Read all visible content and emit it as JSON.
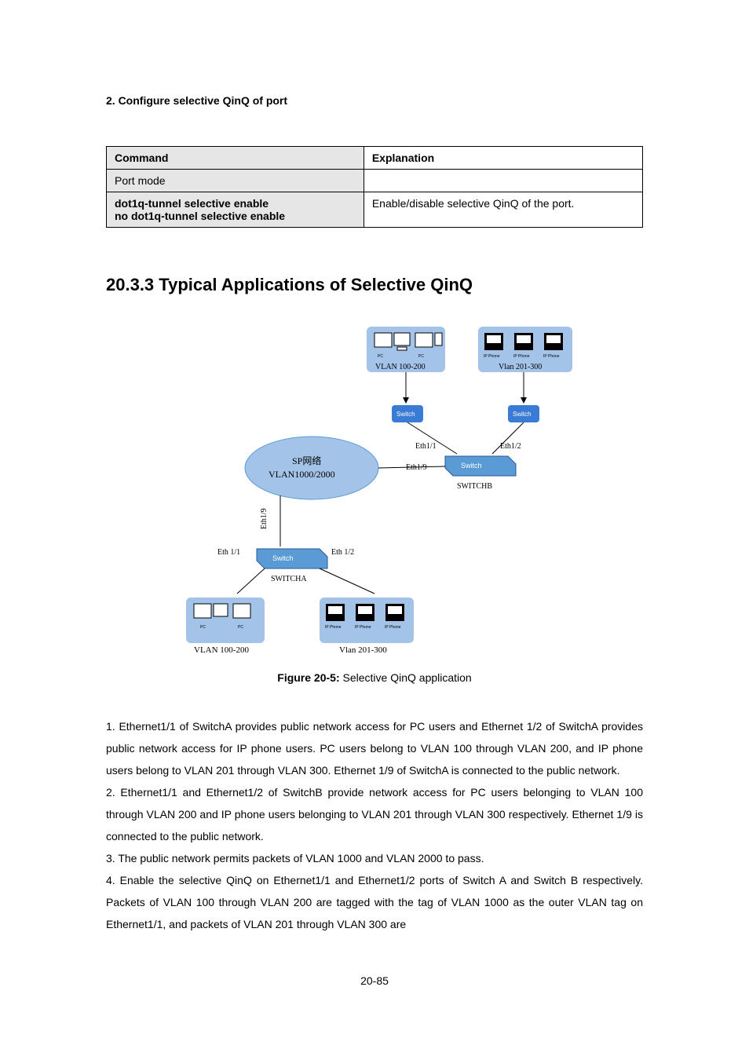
{
  "title_small": "2. Configure selective QinQ of port",
  "table": {
    "header_left": "Command",
    "header_right": "Explanation",
    "row1_left": "Port mode",
    "row2_left_line1": "dot1q-tunnel selective enable",
    "row2_left_line2": "no dot1q-tunnel selective enable",
    "row2_right": "Enable/disable selective QinQ of the port."
  },
  "section_heading": "20.3.3 Typical Applications of Selective QinQ",
  "diagram": {
    "sp_line1": "SP网络",
    "sp_line2": "VLAN1000/2000",
    "vlan_pc": "VLAN 100-200",
    "vlan_phone": "Vlan 201-300",
    "switch": "Switch",
    "switcha": "SWITCHA",
    "switchb": "SWITCHB",
    "eth11": "Eth 1/1",
    "eth12": "Eth 1/2",
    "eth19": "Eth1/9",
    "eth11b": "Eth1/1",
    "eth12b": "Eth1/2",
    "eth19b": "Eth1/9",
    "pc": "PC",
    "ipphone": "IP Phone"
  },
  "figure": {
    "label": "Figure 20-5: ",
    "caption": "Selective QinQ application"
  },
  "paragraphs": {
    "p1": "1. Ethernet1/1 of SwitchA provides public network access for PC users and Ethernet 1/2 of SwitchA provides public network access for IP phone users. PC users belong to VLAN 100 through VLAN 200, and IP phone users belong to VLAN 201 through VLAN 300. Ethernet 1/9 of SwitchA is connected to the public network.",
    "p2": "2. Ethernet1/1 and Ethernet1/2 of SwitchB provide network access for PC users belonging to VLAN 100 through VLAN 200 and IP phone users belonging to VLAN 201 through VLAN 300 respectively. Ethernet 1/9 is connected to the public network.",
    "p3": "3. The public network permits packets of VLAN 1000 and VLAN 2000 to pass.",
    "p4": "4. Enable the selective QinQ on Ethernet1/1 and Ethernet1/2 ports of Switch A and Switch B respectively. Packets of VLAN 100 through VLAN 200 are tagged with the tag of VLAN 1000 as the outer VLAN tag on Ethernet1/1, and packets of VLAN 201 through VLAN 300 are"
  },
  "chart_data": {
    "type": "table",
    "columns": [
      "Command",
      "Explanation"
    ],
    "rows": [
      [
        "Port mode",
        ""
      ],
      [
        "dot1q-tunnel selective enable / no dot1q-tunnel selective enable",
        "Enable/disable selective QinQ of the port."
      ]
    ]
  },
  "page_number": "20-85"
}
